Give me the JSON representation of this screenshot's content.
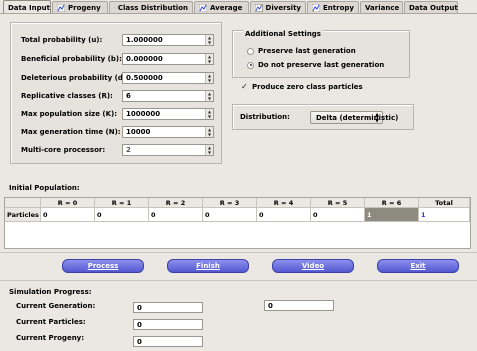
{
  "tabs": [
    {
      "label": "Data Input",
      "icon": "",
      "active": true
    },
    {
      "label": "Progeny",
      "icon": "chart-icon"
    },
    {
      "label": "Class Distribution",
      "icon": "chart-icon"
    },
    {
      "label": "Average",
      "icon": "chart-icon"
    },
    {
      "label": "Diversity",
      "icon": "chart-icon"
    },
    {
      "label": "Entropy",
      "icon": "chart-icon"
    },
    {
      "label": "Variance",
      "icon": ""
    },
    {
      "label": "Data Output",
      "icon": ""
    }
  ],
  "params": [
    {
      "label": "Total probability (u):",
      "value": "1.000000"
    },
    {
      "label": "Beneficial probability (b):",
      "value": "0.000000"
    },
    {
      "label": "Deleterious probability (d):",
      "value": "0.500000"
    },
    {
      "label": "Replicative classes (R):",
      "value": "6"
    },
    {
      "label": "Max population size (K):",
      "value": "1000000"
    },
    {
      "label": "Max generation time (N):",
      "value": "10000"
    },
    {
      "label": "Multi-core processor:",
      "value": "2"
    }
  ],
  "additional": {
    "title": "Additional Settings",
    "radio1": "Preserve last generation",
    "radio2": "Do not preserve last generation",
    "check": "Produce zero class particles"
  },
  "distribution": {
    "label": "Distribution:",
    "value": "Delta (deterministic)"
  },
  "initial_population": {
    "title": "Initial Population:",
    "columns": [
      "R = 0",
      "R = 1",
      "R = 2",
      "R = 3",
      "R = 4",
      "R = 5",
      "R = 6",
      "Total"
    ],
    "row_label": "Particles",
    "values": [
      "0",
      "0",
      "0",
      "0",
      "0",
      "0",
      "1",
      "1"
    ]
  },
  "buttons": {
    "process": "Process",
    "finish": "Finish",
    "video": "Video",
    "exit": "Exit"
  },
  "progress": {
    "title": "Simulation Progress:",
    "gen_label": "Current Generation:",
    "particles_label": "Current Particles:",
    "progeny_label": "Current Progeny:",
    "gen_value": "0",
    "particles_value": "0",
    "progeny_value": "0",
    "right_value": "0"
  },
  "colors": {
    "button": "#6166dc",
    "gray_cell": "#8d8a7f",
    "total_text": "#1a3fd6"
  }
}
